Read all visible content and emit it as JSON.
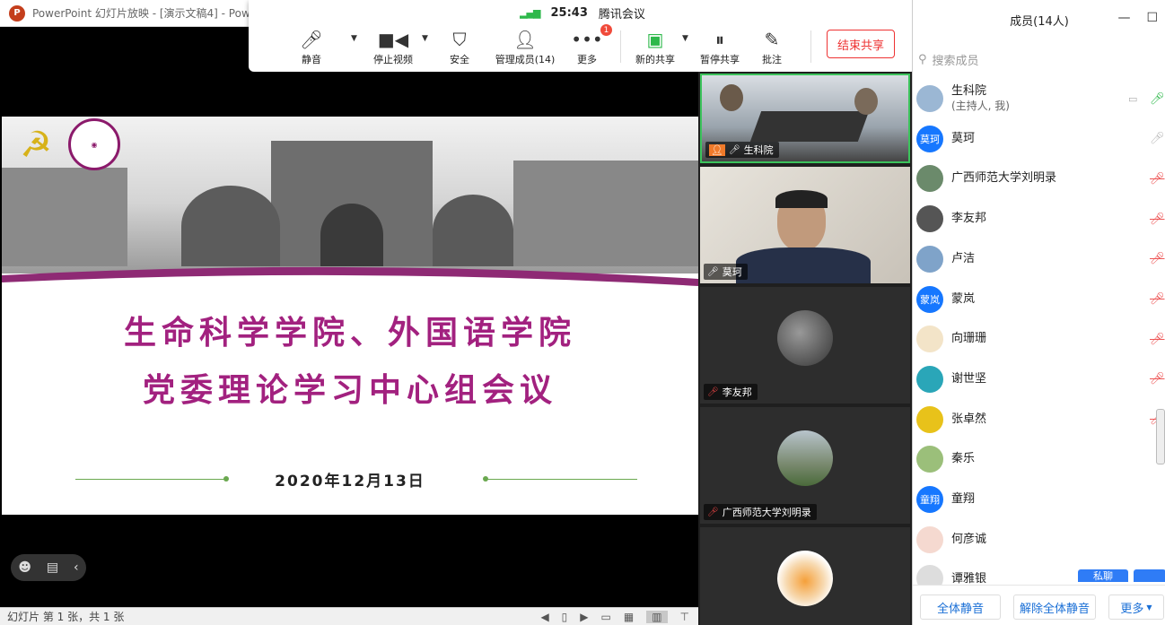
{
  "ppt": {
    "logo": "P",
    "title": "PowerPoint 幻灯片放映 - [演示文稿4] - Pow",
    "status": "幻灯片 第 1 张，共 1 张",
    "slide": {
      "title_line1": "生命科学学院、外国语学院",
      "title_line2": "党委理论学习中心组会议",
      "date": "2020年12月13日"
    }
  },
  "toolbar": {
    "time": "25:43",
    "app_name": "腾讯会议",
    "buttons": {
      "mute": "静音",
      "stop_video": "停止视频",
      "security": "安全",
      "manage_members": "管理成员(14)",
      "more": "更多",
      "new_share": "新的共享",
      "pause_share": "暂停共享",
      "annotate": "批注"
    },
    "more_badge": "1",
    "end_share": "结束共享"
  },
  "videos": [
    {
      "name": "生科院"
    },
    {
      "name": "莫珂"
    },
    {
      "name": "李友邦"
    },
    {
      "name": "广西师范大学刘明录"
    }
  ],
  "members": {
    "title": "成员(14人)",
    "search_placeholder": "搜索成员",
    "list": [
      {
        "name": "生科院",
        "sub": "(主持人, 我)",
        "avatar_color": "#9bb7d4",
        "avatar_text": "",
        "mic": "on"
      },
      {
        "name": "莫珂",
        "avatar_color": "#1677ff",
        "avatar_text": "莫珂",
        "mic": "idle"
      },
      {
        "name": "广西师范大学刘明录",
        "avatar_color": "#6b8a6b",
        "avatar_text": "",
        "mic": "off"
      },
      {
        "name": "李友邦",
        "avatar_color": "#555555",
        "avatar_text": "",
        "mic": "off"
      },
      {
        "name": "卢洁",
        "avatar_color": "#7fa3c9",
        "avatar_text": "",
        "mic": "off"
      },
      {
        "name": "蒙岚",
        "avatar_color": "#1677ff",
        "avatar_text": "蒙岚",
        "mic": "off"
      },
      {
        "name": "向珊珊",
        "avatar_color": "#f3e4c8",
        "avatar_text": "",
        "mic": "off"
      },
      {
        "name": "谢世坚",
        "avatar_color": "#2aa6b8",
        "avatar_text": "",
        "mic": "off"
      },
      {
        "name": "张卓然",
        "avatar_color": "#e8c21a",
        "avatar_text": "",
        "mic": "off"
      },
      {
        "name": "秦乐",
        "avatar_color": "#9bbf7a",
        "avatar_text": "",
        "mic": "none"
      },
      {
        "name": "童翔",
        "avatar_color": "#1677ff",
        "avatar_text": "童翔",
        "mic": "none"
      },
      {
        "name": "何彦诚",
        "avatar_color": "#f5d9d0",
        "avatar_text": "",
        "mic": "none"
      }
    ],
    "partial_row_name": "谭雅银",
    "chat_button": "私聊",
    "footer": {
      "mute_all": "全体静音",
      "unmute_all": "解除全体静音",
      "more": "更多"
    }
  }
}
